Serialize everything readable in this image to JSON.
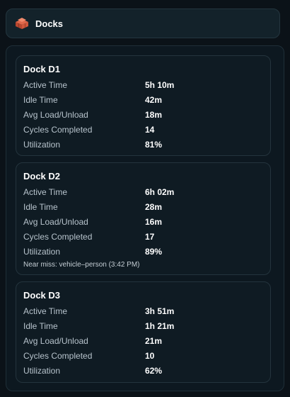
{
  "header": {
    "title": "Docks",
    "icon": "dock-crate-icon"
  },
  "docks": [
    {
      "name": "Dock D1",
      "rows": [
        {
          "label": "Active Time",
          "value": "5h 10m"
        },
        {
          "label": "Idle Time",
          "value": "42m"
        },
        {
          "label": "Avg Load/Unload",
          "value": "18m"
        },
        {
          "label": "Cycles Completed",
          "value": "14"
        },
        {
          "label": "Utilization",
          "value": "81%"
        }
      ],
      "note": ""
    },
    {
      "name": "Dock D2",
      "rows": [
        {
          "label": "Active Time",
          "value": "6h 02m"
        },
        {
          "label": "Idle Time",
          "value": "28m"
        },
        {
          "label": "Avg Load/Unload",
          "value": "16m"
        },
        {
          "label": "Cycles Completed",
          "value": "17"
        },
        {
          "label": "Utilization",
          "value": "89%"
        }
      ],
      "note": "Near miss: vehicle–person (3:42 PM)"
    },
    {
      "name": "Dock D3",
      "rows": [
        {
          "label": "Active Time",
          "value": "3h 51m"
        },
        {
          "label": "Idle Time",
          "value": "1h 21m"
        },
        {
          "label": "Avg Load/Unload",
          "value": "21m"
        },
        {
          "label": "Cycles Completed",
          "value": "10"
        },
        {
          "label": "Utilization",
          "value": "62%"
        }
      ],
      "note": ""
    }
  ]
}
